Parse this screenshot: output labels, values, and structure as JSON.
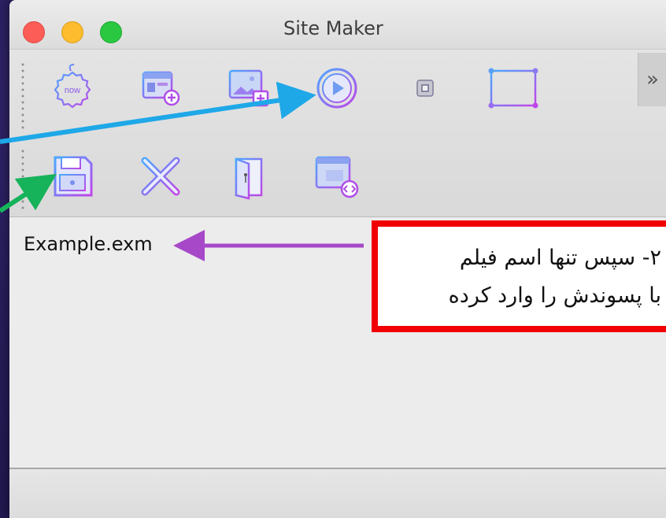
{
  "window": {
    "title": "Site Maker"
  },
  "toolbar": {
    "row1": [
      {
        "icon": "new-badge-icon",
        "label": "now"
      },
      {
        "icon": "window-add-icon"
      },
      {
        "icon": "image-add-icon"
      },
      {
        "icon": "play-circle-icon"
      },
      {
        "icon": "stop-small-icon"
      },
      {
        "icon": "selection-rect-icon"
      }
    ],
    "row2": [
      {
        "icon": "save-floppy-icon"
      },
      {
        "icon": "close-x-icon"
      },
      {
        "icon": "door-exit-icon"
      },
      {
        "icon": "preview-window-icon"
      }
    ],
    "overflow_glyph": "»"
  },
  "content": {
    "filename": "Example.exm"
  },
  "annotation": {
    "line1": "۲- سپس تنها اسم فیلم",
    "line2": "با پسوندش را وارد کرده"
  },
  "colors": {
    "icon_gradient_start": "#4aa8ff",
    "icon_gradient_end": "#c045e8",
    "arrow_blue": "#1ea8e8",
    "arrow_green": "#16b35a",
    "arrow_purple": "#a748c9",
    "annotation_border": "#f00000"
  }
}
